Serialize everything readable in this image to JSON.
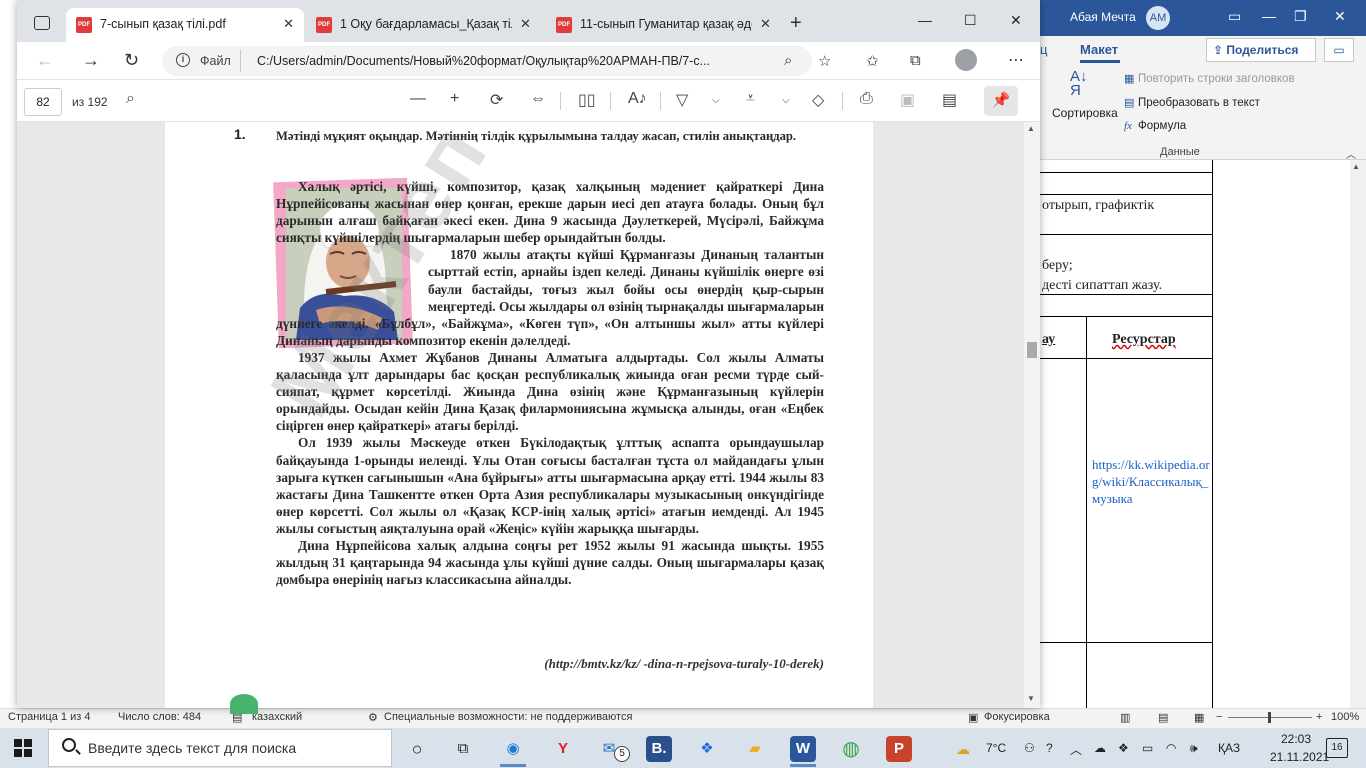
{
  "browser": {
    "tabs": [
      {
        "label": "7-сынып қазақ тілі.pdf",
        "active": true
      },
      {
        "label": "1 Оқу бағдарламасы_Қазақ тілі",
        "active": false
      },
      {
        "label": "11-сынып Гуманитар қазақ әде",
        "active": false
      }
    ],
    "new_tab": "+",
    "url_label": "Файл",
    "url": "C:/Users/admin/Documents/Новый%20формат/Оқулықтар%20АРМАН-ПВ/7-с...",
    "window_controls": {
      "minimize": "—",
      "maximize": "☐",
      "close": "✕"
    }
  },
  "pdf_toolbar": {
    "page": "82",
    "total": "из 192"
  },
  "pdf_page": {
    "task_number": "1.",
    "task_text": "Мәтінді мұқият оқыңдар. Мәтіннің тілдік құрылымына талдау жасап, стилін анықтаңдар.",
    "paragraphs": [
      "Халық әртісі, күйші, композитор, қазақ халқының мәдениет қайраткері Дина Нұрпейісованы жасынан өнер қонған, ерекше дарын иесі деп атауға болады. Оның бұл дарынын алғаш байқаған әкесі екен. Дина 9 жасында Дәулеткерей, Мүсірәлі, Байжұма сияқты күйшілердің шығармаларын шебер орындайтын болды.",
      "1870 жылы атақты күйші Құрманғазы Динаның талантын сырттай естіп, арнайы іздеп келеді. Динаны күйшілік өнерге өзі баули бастайды, тоғыз жыл бойы осы өнердің қыр-сырын меңгертеді. Осы жылдары ол өзінің тырнақалды шығармаларын дүниеге әкелді. «Бұлбұл», «Байжұма», «Көген түп», «Он алтыншы жыл» атты күйлері Динаның дарынды композитор екенін дәлелдеді.",
      "1937 жылы Ахмет Жұбанов Динаны Алматыға алдыртады. Сол жылы Алматы қаласында ұлт дарындары бас қосқан республикалық жиында оған ресми түрде сый-сияпат, құрмет көрсетілді. Жиында Дина өзінің және Құрманғазының күйлерін орындайды. Осыдан кейін Дина Қазақ филармониясына жұмысқа алынды, оған «Еңбек сіңірген өнер қайраткері» атағы берілді.",
      "Ол 1939 жылы Мәскеуде өткен Бүкілодақтық ұлттық аспапта орындаушылар байқауында 1-орынды иеленді. Ұлы Отан соғысы басталған тұста ол майдандағы ұлын зарыға күткен сағынышын «Ана бұйрығы» атты шығармасына арқау етті. 1944 жылы 83 жастағы Дина Ташкентте өткен Орта Азия республикалары музыкасының онкүндігінде өнер көрсетті. Сол жылы ол «Қазақ КСР-інің халық әртісі» атағын иемденді. Ал 1945 жылы соғыстың аяқталуына орай «Жеңіс» күйін жарыққа шығарды.",
      "Дина Нұрпейісова халық алдына соңғы рет 1952 жылы 91 жасында шықты. 1955 жылдың 31 қаңтарында 94 жасында ұлы күйші дүние салды. Оның шығармалары қазақ домбыра өнерінің нағыз классикасына айналды."
    ],
    "source": "(http://bmtv.kz/kz/ -dina-n-rpejsova-turaly-10-derek)",
    "watermark": "Мектеп"
  },
  "word": {
    "user_name": "Абая Мечта",
    "avatar": "АМ",
    "tab_partial": "ц",
    "tab_active": "Макет",
    "share_label": "Поделиться",
    "ribbon": {
      "sort_label": "Сортировка",
      "repeat_headers": "Повторить строки заголовков",
      "convert_text": "Преобразовать в текст",
      "formula": "Формула",
      "group": "Данные"
    },
    "doc": {
      "line1": "отырып, графиктік",
      "line2": "беру;",
      "line3": "десті сипаттап жазу.",
      "th_partial": "ау",
      "th_resources": "Ресурстар",
      "link": "https://kk.wikipedia.org/wiki/Классикалық_музыка"
    },
    "status": {
      "page": "Страница 1 из 4",
      "words": "Число слов: 484",
      "lang": "казахский",
      "accessibility": "Специальные возможности: не поддерживаются",
      "focus": "Фокусировка",
      "zoom": "100%"
    }
  },
  "taskbar": {
    "search_placeholder": "Введите здесь текст для поиска",
    "mail_badge": "5",
    "temperature": "7°C",
    "lang": "ҚАЗ",
    "time": "22:03",
    "date": "21.11.2021",
    "notifications": "16"
  }
}
